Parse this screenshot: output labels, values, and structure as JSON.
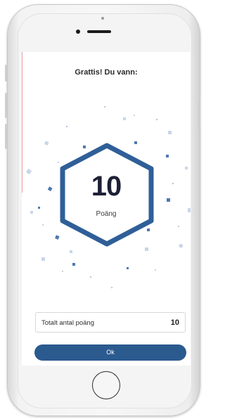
{
  "header": {
    "title": "Grattis! Du vann:"
  },
  "score": {
    "value": "10",
    "label": "Poäng"
  },
  "total": {
    "label": "Totalt antal poäng",
    "value": "10"
  },
  "actions": {
    "ok_label": "Ok"
  },
  "colors": {
    "accent": "#2b5a8f",
    "hexagon": "#2f5f98",
    "confetti": "#4f79b0"
  }
}
